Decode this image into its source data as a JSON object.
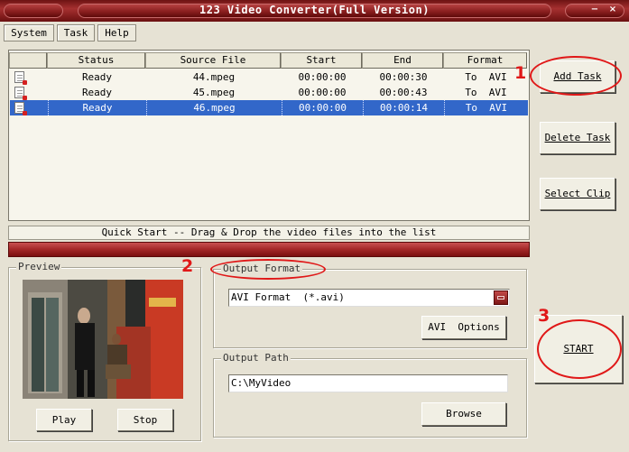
{
  "window": {
    "title": "123 Video Converter(Full Version)",
    "minimize": "−",
    "close": "×"
  },
  "menu": [
    "System",
    "Task",
    "Help"
  ],
  "task_table": {
    "columns": [
      "Status",
      "Source File",
      "Start",
      "End",
      "Format"
    ],
    "rows": [
      {
        "status": "Ready",
        "file": "44.mpeg",
        "start": "00:00:00",
        "end": "00:00:30",
        "format": "To  AVI"
      },
      {
        "status": "Ready",
        "file": "45.mpeg",
        "start": "00:00:00",
        "end": "00:00:43",
        "format": "To  AVI"
      },
      {
        "status": "Ready",
        "file": "46.mpeg",
        "start": "00:00:00",
        "end": "00:00:14",
        "format": "To  AVI"
      }
    ],
    "selected_row": 2
  },
  "quick_start": "Quick Start -- Drag & Drop the video files into the list",
  "side_buttons": {
    "add_task": "Add Task",
    "delete_task": "Delete Task",
    "select_clip": "Select Clip",
    "start": "START"
  },
  "preview": {
    "label": "Preview",
    "play": "Play",
    "stop": "Stop"
  },
  "output_format": {
    "label": "Output Format",
    "value": "AVI Format  (*.avi)",
    "options_button": "AVI  Options"
  },
  "output_path": {
    "label": "Output Path",
    "value": "C:\\MyVideo",
    "browse_button": "Browse"
  },
  "annotations": [
    "1",
    "2",
    "3"
  ],
  "colors": {
    "title_bar": "#8a1f1f",
    "selection": "#3267c9",
    "annotation": "#e01818",
    "progress": "#a32727"
  }
}
